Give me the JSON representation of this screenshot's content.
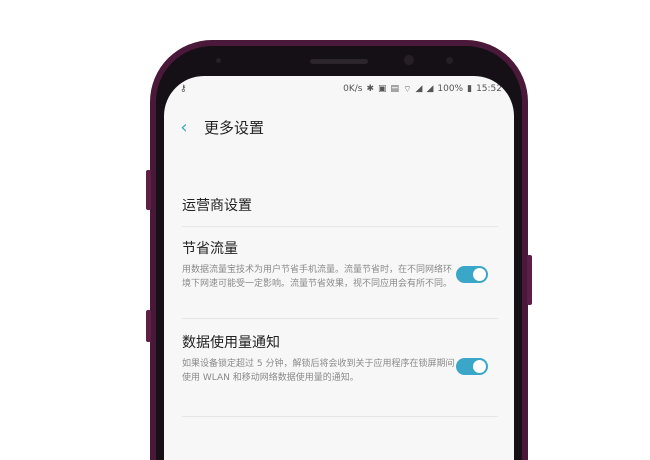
{
  "status_bar": {
    "key_icon": "key-icon",
    "speed": "0K/s",
    "battery_percent": "100%",
    "time": "15:52"
  },
  "header": {
    "back_icon": "chevron-left-icon",
    "title": "更多设置"
  },
  "settings": {
    "carrier": {
      "title": "运营商设置"
    },
    "data_saver": {
      "title": "节省流量",
      "description": "用数据流量宝技术为用户节省手机流量。流量节省时，在不同网络环境下网速可能受一定影响。流量节省效果，视不同应用会有所不同。",
      "enabled": true
    },
    "usage_notification": {
      "title": "数据使用量通知",
      "description": "如果设备锁定超过 5 分钟，解锁后将会收到关于应用程序在锁屏期间使用 WLAN 和移动网络数据使用量的通知。",
      "enabled": true
    }
  },
  "colors": {
    "accent": "#3aa6c8",
    "phone_body": "#4a1838"
  }
}
